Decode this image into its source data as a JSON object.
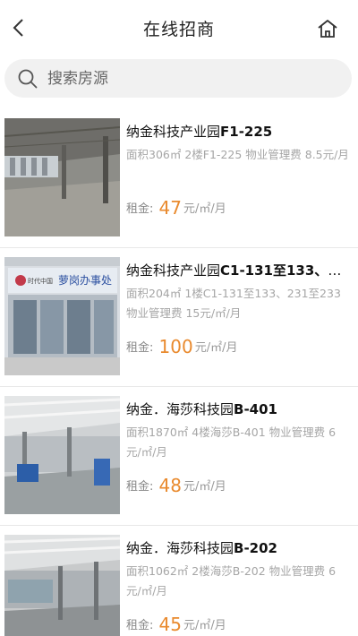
{
  "header": {
    "title": "在线招商",
    "back_icon": "chevron-left-icon",
    "home_icon": "home-icon"
  },
  "search": {
    "placeholder": "搜索房源",
    "icon": "search-icon"
  },
  "listings": [
    {
      "name_prefix": "纳金科技产业园",
      "name_code": "F1-225",
      "desc": "面积306㎡ 2楼F1-225 物业管理费 8.5元/月",
      "rent_label": "租金:",
      "price": "47",
      "unit": "元/㎡/月"
    },
    {
      "name_prefix": "纳金科技产业园",
      "name_code": "C1-131至133、231至233",
      "desc": "面积204㎡ 1楼C1-131至133、231至233 物业管理费 15元/㎡/月",
      "rent_label": "租金:",
      "price": "100",
      "unit": "元/㎡/月",
      "sign_text": "萝岗办事处",
      "logo_text": "时代中国"
    },
    {
      "name_prefix": "纳金．海莎科技园",
      "name_code": "B-401",
      "desc": "面积1870㎡ 4楼海莎B-401 物业管理费 6元/㎡/月",
      "rent_label": "租金:",
      "price": "48",
      "unit": "元/㎡/月"
    },
    {
      "name_prefix": "纳金．海莎科技园",
      "name_code": "B-202",
      "desc": "面积1062㎡ 2楼海莎B-202 物业管理费 6元/㎡/月",
      "rent_label": "租金:",
      "price": "45",
      "unit": "元/㎡/月"
    }
  ],
  "colors": {
    "price": "#e98a2e",
    "desc": "#a6a6a6",
    "search_bg": "#f1f1f1"
  }
}
